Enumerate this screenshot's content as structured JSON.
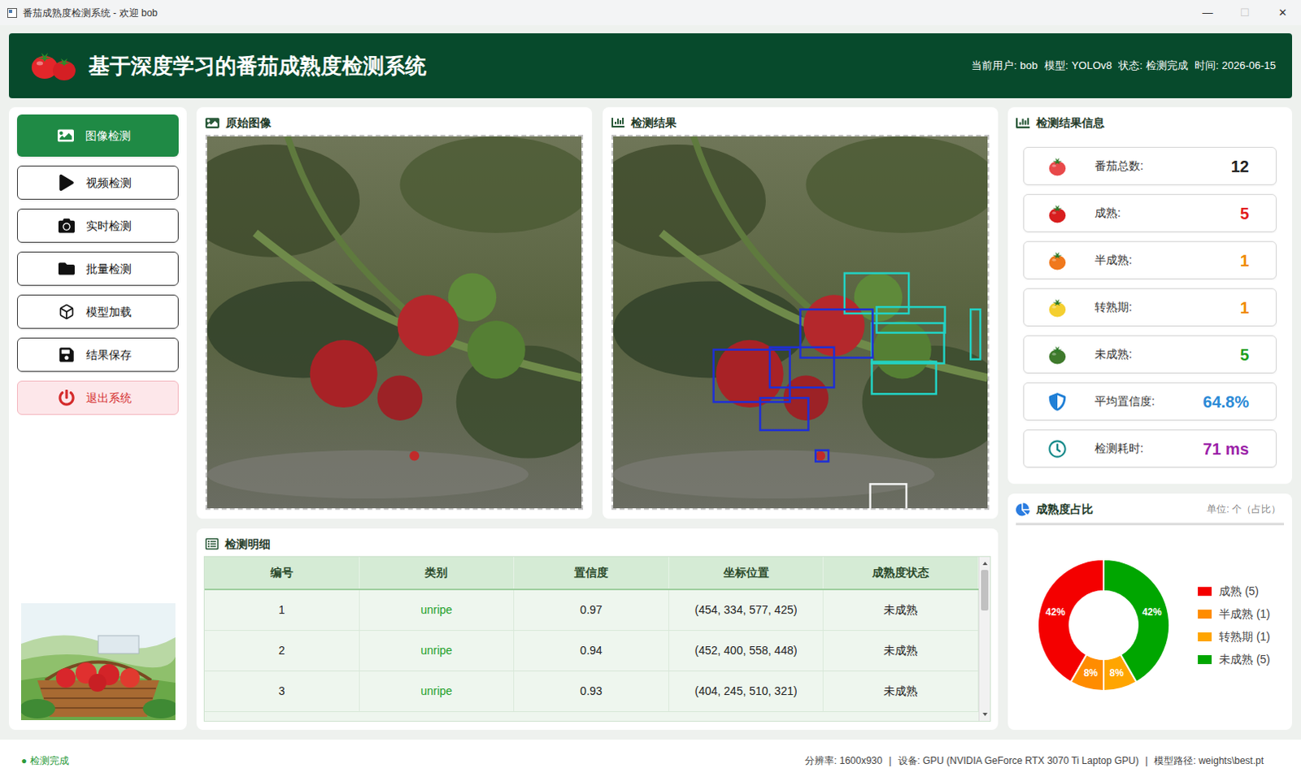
{
  "window": {
    "title": "番茄成熟度检测系统 - 欢迎 bob",
    "controls": [
      {
        "glyph": "—",
        "disabled": false
      },
      {
        "glyph": "☐",
        "disabled": true
      },
      {
        "glyph": "✕",
        "disabled": false
      }
    ]
  },
  "header": {
    "title": "基于深度学习的番茄成熟度检测系统",
    "info": [
      {
        "label": "当前用户:",
        "value": "bob"
      },
      {
        "label": "模型:",
        "value": "YOLOv8"
      },
      {
        "label": "状态:",
        "value": "检测完成"
      },
      {
        "label": "时间:",
        "value": "2026-06-15"
      }
    ]
  },
  "sidebar": {
    "items": [
      {
        "label": "图像检测",
        "selected": true,
        "kind": "normal"
      },
      {
        "label": "视频检测",
        "selected": false,
        "kind": "normal"
      },
      {
        "label": "实时检测",
        "selected": false,
        "kind": "normal"
      },
      {
        "label": "批量检测",
        "selected": false,
        "kind": "normal"
      },
      {
        "label": "模型加载",
        "selected": false,
        "kind": "normal"
      },
      {
        "label": "结果保存",
        "selected": false,
        "kind": "normal"
      },
      {
        "label": "退出系统",
        "selected": false,
        "kind": "danger"
      }
    ]
  },
  "panels": {
    "original": "原始图像",
    "result": "检测结果",
    "details": "检测明细",
    "info": "检测结果信息"
  },
  "table": {
    "columns": [
      "编号",
      "类别",
      "置信度",
      "坐标位置",
      "成熟度状态"
    ],
    "rows": [
      [
        "1",
        "unripe",
        "0.97",
        "(454, 334, 577, 425)",
        "未成熟"
      ],
      [
        "2",
        "unripe",
        "0.94",
        "(452, 400, 558, 448)",
        "未成熟"
      ],
      [
        "3",
        "unripe",
        "0.93",
        "(404, 245, 510, 321)",
        "未成熟"
      ]
    ]
  },
  "stats": [
    {
      "label": "番茄总数:",
      "value": "12",
      "kind": "tomato",
      "icon_color": "#e8494a",
      "color": "#222222"
    },
    {
      "label": "成熟:",
      "value": "5",
      "kind": "tomato",
      "icon_color": "#d81e1e",
      "color": "#e21b1b"
    },
    {
      "label": "半成熟:",
      "value": "1",
      "kind": "tomato",
      "icon_color": "#f0781c",
      "color": "#f08a00"
    },
    {
      "label": "转熟期:",
      "value": "1",
      "kind": "tomato",
      "icon_color": "#f4cf30",
      "color": "#f08a00"
    },
    {
      "label": "未成熟:",
      "value": "5",
      "kind": "tomato",
      "icon_color": "#3f7a2c",
      "color": "#1c9e1c"
    },
    {
      "label": "平均置信度:",
      "value": "64.8%",
      "kind": "shield",
      "icon_color": "#1f7fd6",
      "color": "#2b8ad6"
    },
    {
      "label": "检测耗时:",
      "value": "71 ms",
      "kind": "clock",
      "icon_color": "#138a8a",
      "color": "#9b1fa8"
    }
  ],
  "chart": {
    "title": "成熟度占比",
    "unit": "单位: 个（占比）",
    "values": [
      5,
      1,
      1,
      5
    ],
    "series": [
      {
        "label": "成熟 (5)",
        "percent": "42%",
        "color": "#f40000"
      },
      {
        "label": "半成熟 (1)",
        "percent": "8%",
        "color": "#ff8c00"
      },
      {
        "label": "转熟期 (1)",
        "percent": "8%",
        "color": "#ffa500"
      },
      {
        "label": "未成熟 (5)",
        "percent": "42%",
        "color": "#00a600"
      }
    ]
  },
  "status_bar": {
    "dot": "●",
    "status": "检测完成",
    "separator": "|",
    "items": [
      "分辨率: 1600x930",
      "设备: GPU (NVIDIA GeForce RTX 3070 Ti Laptop GPU)",
      "模型路径: weights\\best.pt"
    ]
  }
}
